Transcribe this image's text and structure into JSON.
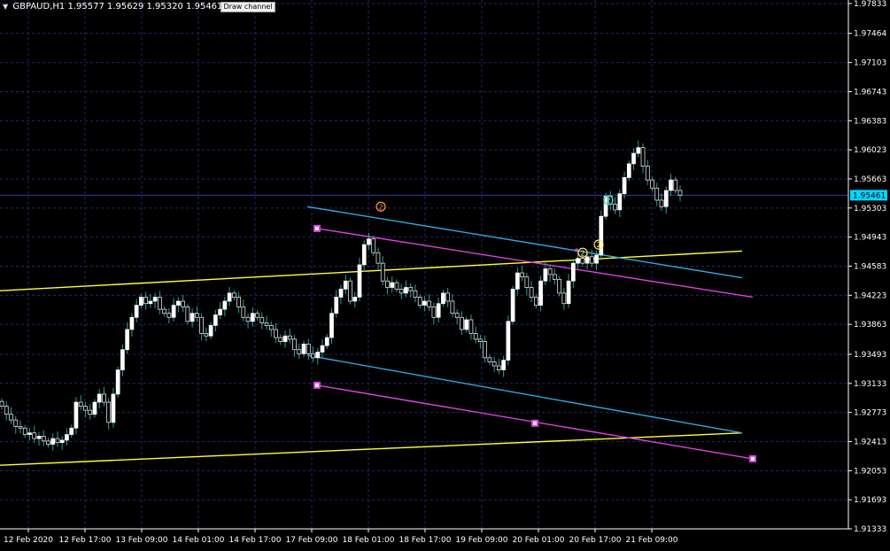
{
  "header": {
    "symbol": "GBPAUD,H1",
    "prices": "1.95577 1.95629 1.95320 1.95461",
    "draw_channel_button": "Draw channel"
  },
  "current_price": "1.95461",
  "colors": {
    "background": "#000000",
    "grid": "#1f2a6b",
    "bull_candle": "#ffffff",
    "bear_candle": "#000000",
    "wick": "#2aa198",
    "channel_cyan": "#2fa8e0",
    "channel_magenta": "#e040e0",
    "channel_yellow": "#ffff33",
    "price_line": "#3a3aa0",
    "price_label_bg": "#00d9ff"
  },
  "chart_data": {
    "type": "candlestick",
    "symbol": "GBPAUD",
    "timeframe": "H1",
    "ylim": [
      1.91333,
      1.97833
    ],
    "y_ticks": [
      "1.97833",
      "1.97464",
      "1.97103",
      "1.96743",
      "1.96383",
      "1.96023",
      "1.95663",
      "1.95303",
      "1.94943",
      "1.94583",
      "1.94223",
      "1.93863",
      "1.93493",
      "1.93133",
      "1.92773",
      "1.92413",
      "1.92053",
      "1.91693",
      "1.91333"
    ],
    "x_ticks": [
      "12 Feb 2020",
      "12 Feb 17:00",
      "13 Feb 09:00",
      "14 Feb 01:00",
      "14 Feb 17:00",
      "17 Feb 09:00",
      "18 Feb 01:00",
      "18 Feb 17:00",
      "19 Feb 09:00",
      "20 Feb 01:00",
      "20 Feb 17:00",
      "21 Feb 09:00"
    ],
    "close_series": [
      1.9285,
      1.9275,
      1.9268,
      1.926,
      1.9258,
      1.925,
      1.9252,
      1.9245,
      1.9248,
      1.9242,
      1.9238,
      1.9245,
      1.924,
      1.9243,
      1.925,
      1.9258,
      1.929,
      1.9285,
      1.928,
      1.9275,
      1.929,
      1.93,
      1.929,
      1.9265,
      1.93,
      1.933,
      1.9355,
      1.938,
      1.9395,
      1.941,
      1.942,
      1.9412,
      1.9415,
      1.942,
      1.9405,
      1.94,
      1.9395,
      1.941,
      1.9415,
      1.9408,
      1.939,
      1.94,
      1.9395,
      1.9375,
      1.9372,
      1.9385,
      1.9398,
      1.9405,
      1.9415,
      1.9425,
      1.942,
      1.9408,
      1.9395,
      1.939,
      1.94,
      1.9395,
      1.9388,
      1.9385,
      1.938,
      1.937,
      1.9365,
      1.9372,
      1.9368,
      1.9355,
      1.935,
      1.9362,
      1.935,
      1.9345,
      1.9352,
      1.936,
      1.937,
      1.94,
      1.942,
      1.943,
      1.944,
      1.9415,
      1.942,
      1.946,
      1.9485,
      1.9492,
      1.9475,
      1.9462,
      1.944,
      1.9432,
      1.9438,
      1.943,
      1.9425,
      1.9432,
      1.9428,
      1.942,
      1.941,
      1.9415,
      1.9408,
      1.9395,
      1.9412,
      1.9425,
      1.9415,
      1.94,
      1.9395,
      1.938,
      1.9392,
      1.9375,
      1.9368,
      1.9365,
      1.9345,
      1.934,
      1.9335,
      1.933,
      1.9342,
      1.939,
      1.943,
      1.945,
      1.9445,
      1.9432,
      1.942,
      1.941,
      1.944,
      1.9455,
      1.9448,
      1.9442,
      1.9425,
      1.9412,
      1.944,
      1.9462,
      1.9468,
      1.9462,
      1.947,
      1.9462,
      1.9472,
      1.952,
      1.9545,
      1.9535,
      1.9528,
      1.9548,
      1.9568,
      1.9585,
      1.9598,
      1.9605,
      1.9582,
      1.9565,
      1.9555,
      1.954,
      1.9532,
      1.9552,
      1.9565,
      1.9552,
      1.9546
    ],
    "channel_cyan": {
      "upper": [
        [
          1.9532,
          1.9444
        ]
      ],
      "lower": [
        [
          1.9348,
          1.9252
        ]
      ]
    },
    "channel_magenta": {
      "upper": [
        [
          1.9505,
          1.942
        ]
      ],
      "lower": [
        [
          1.9311,
          1.922
        ]
      ]
    },
    "channel_yellow": {
      "upper": [
        [
          1.9428,
          1.9477
        ]
      ],
      "lower": [
        [
          1.9212,
          1.9252
        ]
      ]
    },
    "markers": [
      {
        "label": "2",
        "color": "#ff9a3c"
      },
      {
        "label": "2",
        "color": "#ffe066"
      },
      {
        "label": "2",
        "color": "#ffe066"
      },
      {
        "label": "2",
        "color": "#39d0c0"
      }
    ]
  }
}
